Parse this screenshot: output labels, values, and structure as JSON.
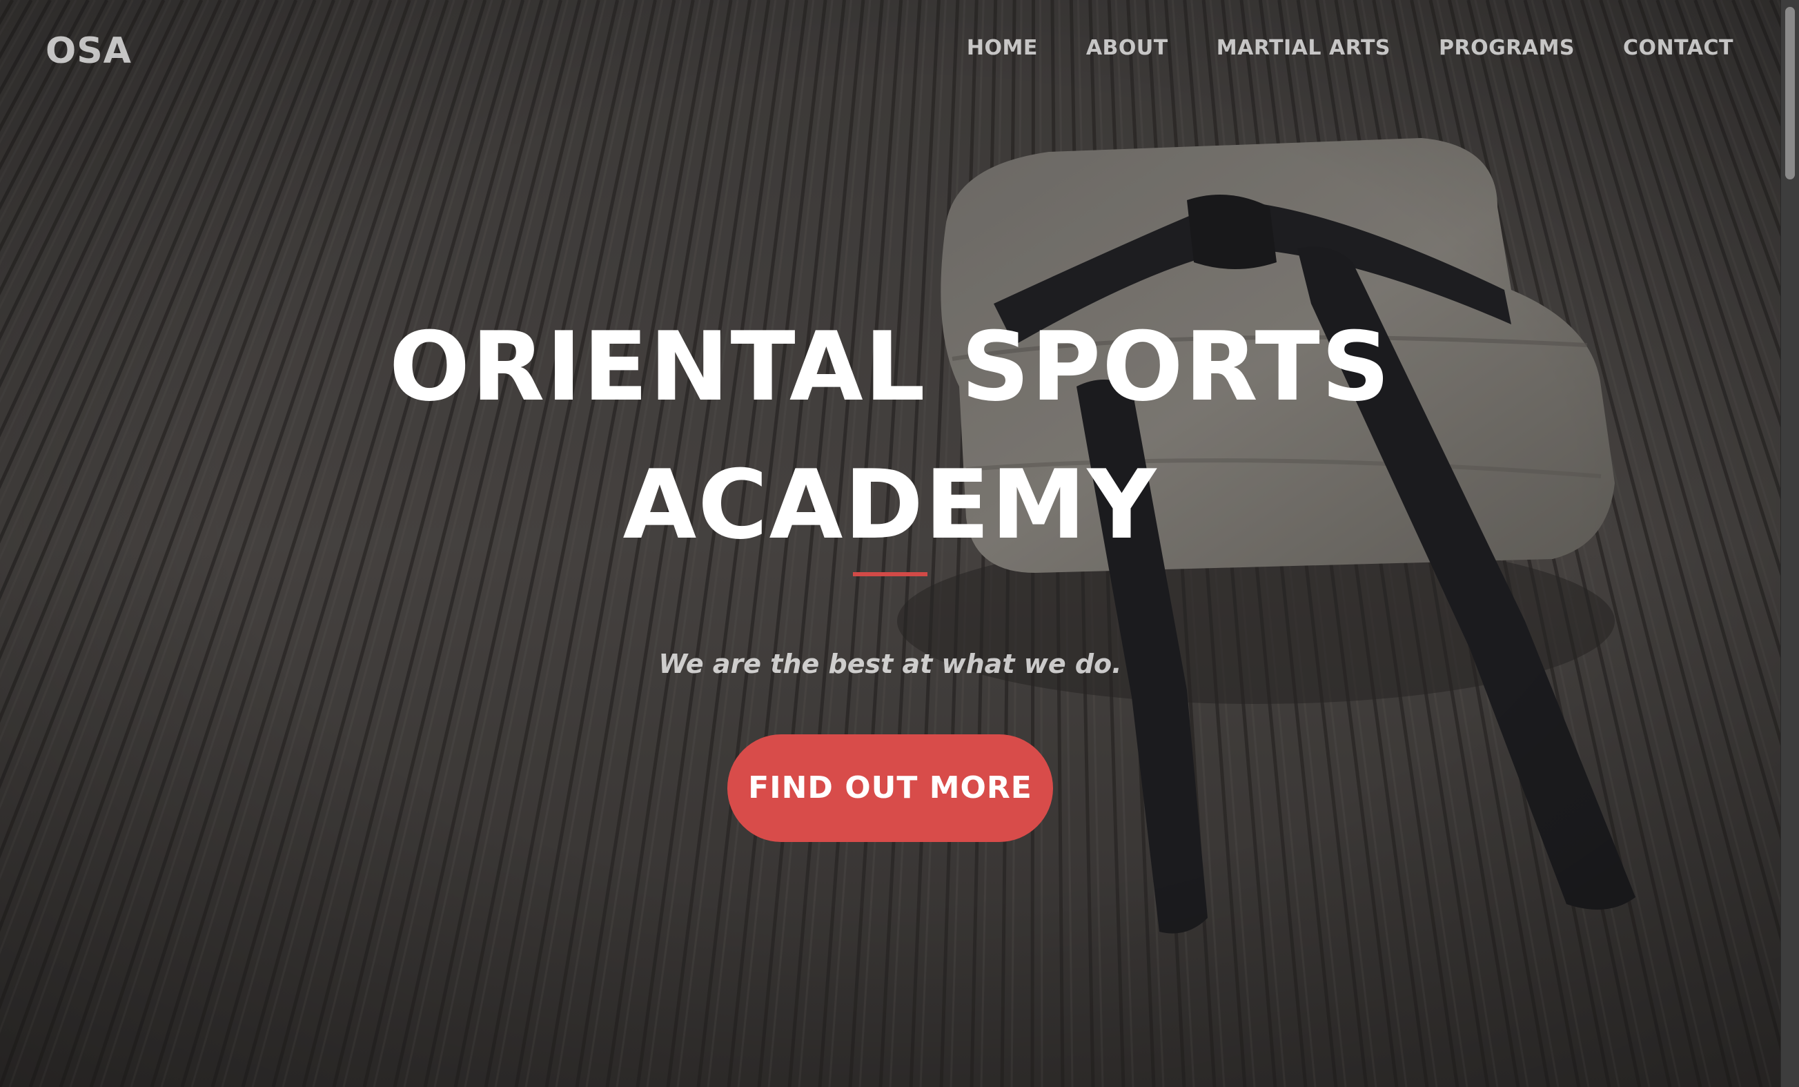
{
  "nav": {
    "brand": "OSA",
    "links": [
      {
        "label": "HOME"
      },
      {
        "label": "ABOUT"
      },
      {
        "label": "MARTIAL ARTS"
      },
      {
        "label": "PROGRAMS"
      },
      {
        "label": "CONTACT"
      }
    ]
  },
  "hero": {
    "title_line1": "ORIENTAL SPORTS",
    "title_line2": "ACADEMY",
    "tagline": "We are the best at what we do.",
    "cta_label": "FIND OUT MORE",
    "background_image": "folded white martial arts uniform with black belt on bamboo mat"
  },
  "colors": {
    "accent": "#d84c4a",
    "overlay": "#2a2a2a",
    "nav_text": "#c8c8c8",
    "title_text": "#ffffff"
  }
}
